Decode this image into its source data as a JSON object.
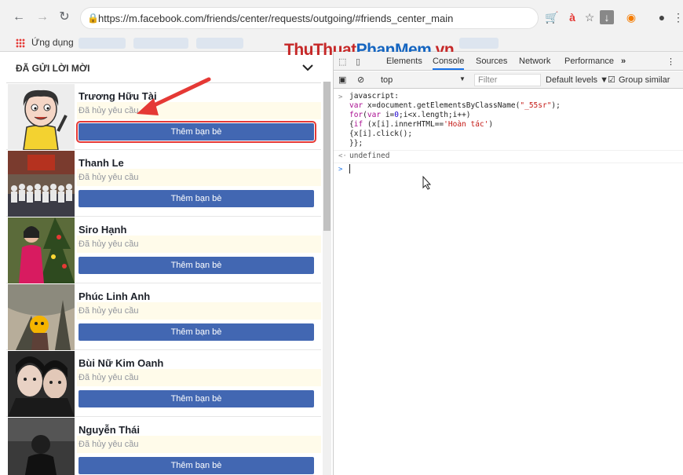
{
  "browser": {
    "url": "https://m.facebook.com/friends/center/requests/outgoing/#friends_center_main",
    "bookmark_apps_label": "Ứng dụng"
  },
  "watermark": {
    "part1": "ThuThuat",
    "part2": "PhanMem",
    "part3": ".vn"
  },
  "left_panel": {
    "section_title": "ĐÃ GỬI LỜI MỜI",
    "friends": [
      {
        "name": "Trương Hữu Tài",
        "status": "Đã hủy yêu cầu",
        "button": "Thêm bạn bè"
      },
      {
        "name": "Thanh Le",
        "status": "Đã hủy yêu cầu",
        "button": "Thêm bạn bè"
      },
      {
        "name": "Siro Hạnh",
        "status": "Đã hủy yêu cầu",
        "button": "Thêm bạn bè"
      },
      {
        "name": "Phúc Linh Anh",
        "status": "Đã hủy yêu cầu",
        "button": "Thêm bạn bè"
      },
      {
        "name": "Bùi Nữ Kim Oanh",
        "status": "Đã hủy yêu cầu",
        "button": "Thêm bạn bè"
      },
      {
        "name": "Nguyễn Thái",
        "status": "Đã hủy yêu cầu",
        "button": "Thêm bạn bè"
      }
    ]
  },
  "devtools": {
    "tabs": [
      "Elements",
      "Console",
      "Sources",
      "Network",
      "Performance"
    ],
    "active_tab": "Console",
    "context": "top",
    "filter_placeholder": "Filter",
    "levels": "Default levels ▼",
    "group_similar": "Group similar",
    "result": "undefined"
  },
  "colors": {
    "accent": "#4267b2",
    "highlight": "#e53935",
    "status_bg": "#fffbea"
  }
}
